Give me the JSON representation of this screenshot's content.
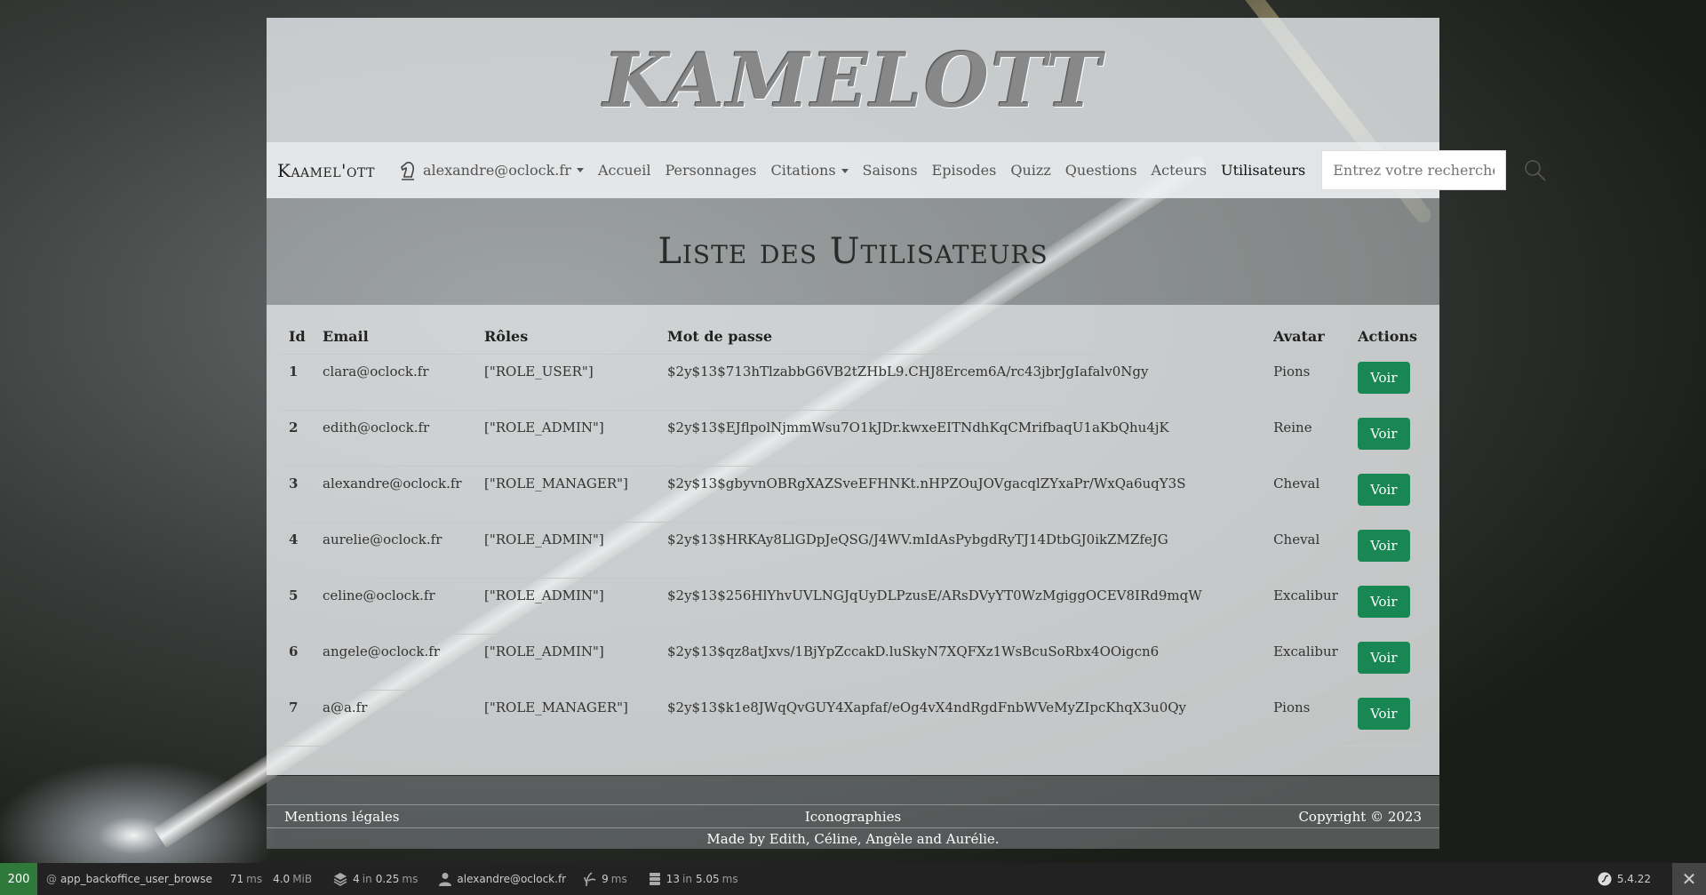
{
  "banner": {
    "logo_text": "KAMELOTT"
  },
  "nav": {
    "brand": "Kaamel'ott",
    "user_email": "alexandre@oclock.fr",
    "links": [
      "Accueil",
      "Personnages",
      "Citations",
      "Saisons",
      "Episodes",
      "Quizz",
      "Questions",
      "Acteurs",
      "Utilisateurs"
    ],
    "active": "Utilisateurs",
    "search_placeholder": "Entrez votre recherche"
  },
  "page": {
    "title": "Liste des Utilisateurs"
  },
  "table": {
    "headers": [
      "Id",
      "Email",
      "Rôles",
      "Mot de passe",
      "Avatar",
      "Actions"
    ],
    "rows": [
      {
        "id": "1",
        "email": "clara@oclock.fr",
        "roles": "[\"ROLE_USER\"]",
        "password": "$2y$13$713hTlzabbG6VB2tZHbL9.CHJ8Ercem6A/rc43jbrJgIafalv0Ngy",
        "avatar": "Pions",
        "action": "Voir"
      },
      {
        "id": "2",
        "email": "edith@oclock.fr",
        "roles": "[\"ROLE_ADMIN\"]",
        "password": "$2y$13$EJflpolNjmmWsu7O1kJDr.kwxeEITNdhKqCMrifbaqU1aKbQhu4jK",
        "avatar": "Reine",
        "action": "Voir"
      },
      {
        "id": "3",
        "email": "alexandre@oclock.fr",
        "roles": "[\"ROLE_MANAGER\"]",
        "password": "$2y$13$gbyvnOBRgXAZSveEFHNKt.nHPZOuJOVgacqlZYxaPr/WxQa6uqY3S",
        "avatar": "Cheval",
        "action": "Voir"
      },
      {
        "id": "4",
        "email": "aurelie@oclock.fr",
        "roles": "[\"ROLE_ADMIN\"]",
        "password": "$2y$13$HRKAy8LlGDpJeQSG/J4WV.mIdAsPybgdRyTJ14DtbGJ0ikZMZfeJG",
        "avatar": "Cheval",
        "action": "Voir"
      },
      {
        "id": "5",
        "email": "celine@oclock.fr",
        "roles": "[\"ROLE_ADMIN\"]",
        "password": "$2y$13$256HlYhvUVLNGJqUyDLPzusE/ARsDVyYT0WzMgiggOCEV8IRd9mqW",
        "avatar": "Excalibur",
        "action": "Voir"
      },
      {
        "id": "6",
        "email": "angele@oclock.fr",
        "roles": "[\"ROLE_ADMIN\"]",
        "password": "$2y$13$qz8atJxvs/1BjYpZccakD.luSkyN7XQFXz1WsBcuSoRbx4OOigcn6",
        "avatar": "Excalibur",
        "action": "Voir"
      },
      {
        "id": "7",
        "email": "a@a.fr",
        "roles": "[\"ROLE_MANAGER\"]",
        "password": "$2y$13$k1e8JWqQvGUY4Xapfaf/eOg4vX4ndRgdFnbWVeMyZIpcKhqX3u0Qy",
        "avatar": "Pions",
        "action": "Voir"
      }
    ]
  },
  "footer": {
    "legal": "Mentions légales",
    "iconographies": "Iconographies",
    "copyright": "Copyright © 2023",
    "made_by": "Made by Edith, Céline, Angèle and Aurélie."
  },
  "debug_toolbar": {
    "status": "200",
    "route_prefix": "@",
    "route": "app_backoffice_user_browse",
    "time_value": "71",
    "time_unit": "ms",
    "memory_value": "4.0",
    "memory_unit": "MiB",
    "cache_count": "4",
    "cache_in": "in",
    "cache_time": "0.25",
    "cache_unit": "ms",
    "user": "alexandre@oclock.fr",
    "twig_time": "9",
    "twig_unit": "ms",
    "db_count": "13",
    "db_in": "in",
    "db_time": "5.05",
    "db_unit": "ms",
    "symfony_version": "5.4.22"
  },
  "colors": {
    "voir_button": "#198754",
    "toolbar_status": "#2f7a3b"
  }
}
